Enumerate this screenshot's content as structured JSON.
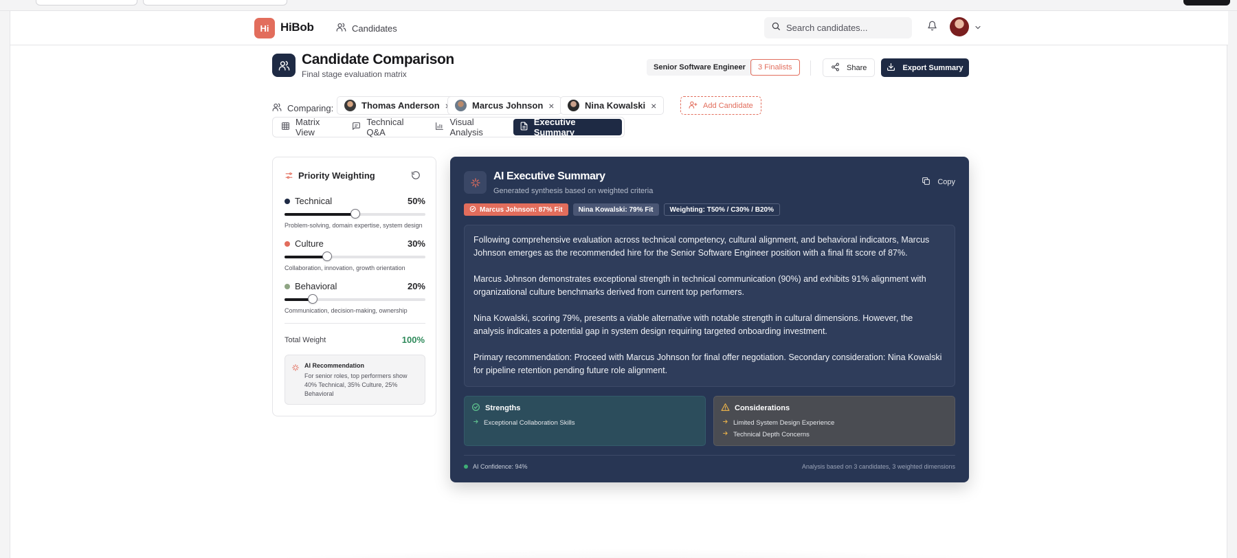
{
  "app": {
    "logo_text": "Hi",
    "brand": "HiBob"
  },
  "nav": {
    "candidates_label": "Candidates",
    "search_placeholder": "Search candidates..."
  },
  "header": {
    "title": "Candidate Comparison",
    "subtitle": "Final stage evaluation matrix",
    "role_badge": "Senior Software Engineer",
    "finalists_badge": "3 Finalists",
    "share_label": "Share",
    "export_label": "Export Summary"
  },
  "comparing": {
    "label": "Comparing:",
    "candidates": [
      {
        "name": "Thomas Anderson"
      },
      {
        "name": "Marcus Johnson"
      },
      {
        "name": "Nina Kowalski"
      }
    ],
    "remove_glyph": "×",
    "add_label": "Add Candidate"
  },
  "tabs": [
    {
      "label": "Matrix View",
      "icon": "grid-icon"
    },
    {
      "label": "Technical Q&A",
      "icon": "message-icon"
    },
    {
      "label": "Visual Analysis",
      "icon": "bar-chart-icon"
    },
    {
      "label": "Executive Summary",
      "icon": "document-icon",
      "active": true
    }
  ],
  "weighting": {
    "title": "Priority Weighting",
    "criteria": [
      {
        "name": "Technical",
        "percent": "50%",
        "value": 50,
        "color": "#1e2a44",
        "description": "Problem-solving, domain expertise, system design"
      },
      {
        "name": "Culture",
        "percent": "30%",
        "value": 30,
        "color": "#e26d5c",
        "description": "Collaboration, innovation, growth orientation"
      },
      {
        "name": "Behavioral",
        "percent": "20%",
        "value": 20,
        "color": "#8fa584",
        "description": "Communication, decision-making, ownership"
      }
    ],
    "total_label": "Total Weight",
    "total_value": "100%",
    "ai_recommendation_title": "AI Recommendation",
    "ai_recommendation_text": "For senior roles, top performers show 40% Technical, 35% Culture, 25% Behavioral"
  },
  "executive": {
    "title": "AI Executive Summary",
    "subtitle": "Generated synthesis based on weighted criteria",
    "copy_label": "Copy",
    "pills": [
      "Marcus Johnson: 87% Fit",
      "Nina Kowalski: 79% Fit",
      "Weighting: T50% / C30% / B20%"
    ],
    "paragraphs": [
      "Following comprehensive evaluation across technical competency, cultural alignment, and behavioral indicators, Marcus Johnson emerges as the recommended hire for the Senior Software Engineer position with a final fit score of 87%.",
      "Marcus Johnson demonstrates exceptional strength in technical communication (90%) and exhibits 91% alignment with organizational culture benchmarks derived from current top performers.",
      "Nina Kowalski, scoring 79%, presents a viable alternative with notable strength in cultural dimensions. However, the analysis indicates a potential gap in system design requiring targeted onboarding investment.",
      "Primary recommendation: Proceed with Marcus Johnson for final offer negotiation. Secondary consideration: Nina Kowalski for pipeline retention pending future role alignment."
    ],
    "strengths_title": "Strengths",
    "strengths": [
      "Exceptional Collaboration Skills"
    ],
    "considerations_title": "Considerations",
    "considerations": [
      "Limited System Design Experience",
      "Technical Depth Concerns"
    ],
    "confidence": "AI Confidence: 94%",
    "analysis_basis": "Analysis based on 3 candidates, 3 weighted dimensions"
  },
  "colors": {
    "accent": "#e26d5c",
    "navy": "#1e2a44",
    "summary_bg": "#283654",
    "success": "#2f8a5b"
  }
}
